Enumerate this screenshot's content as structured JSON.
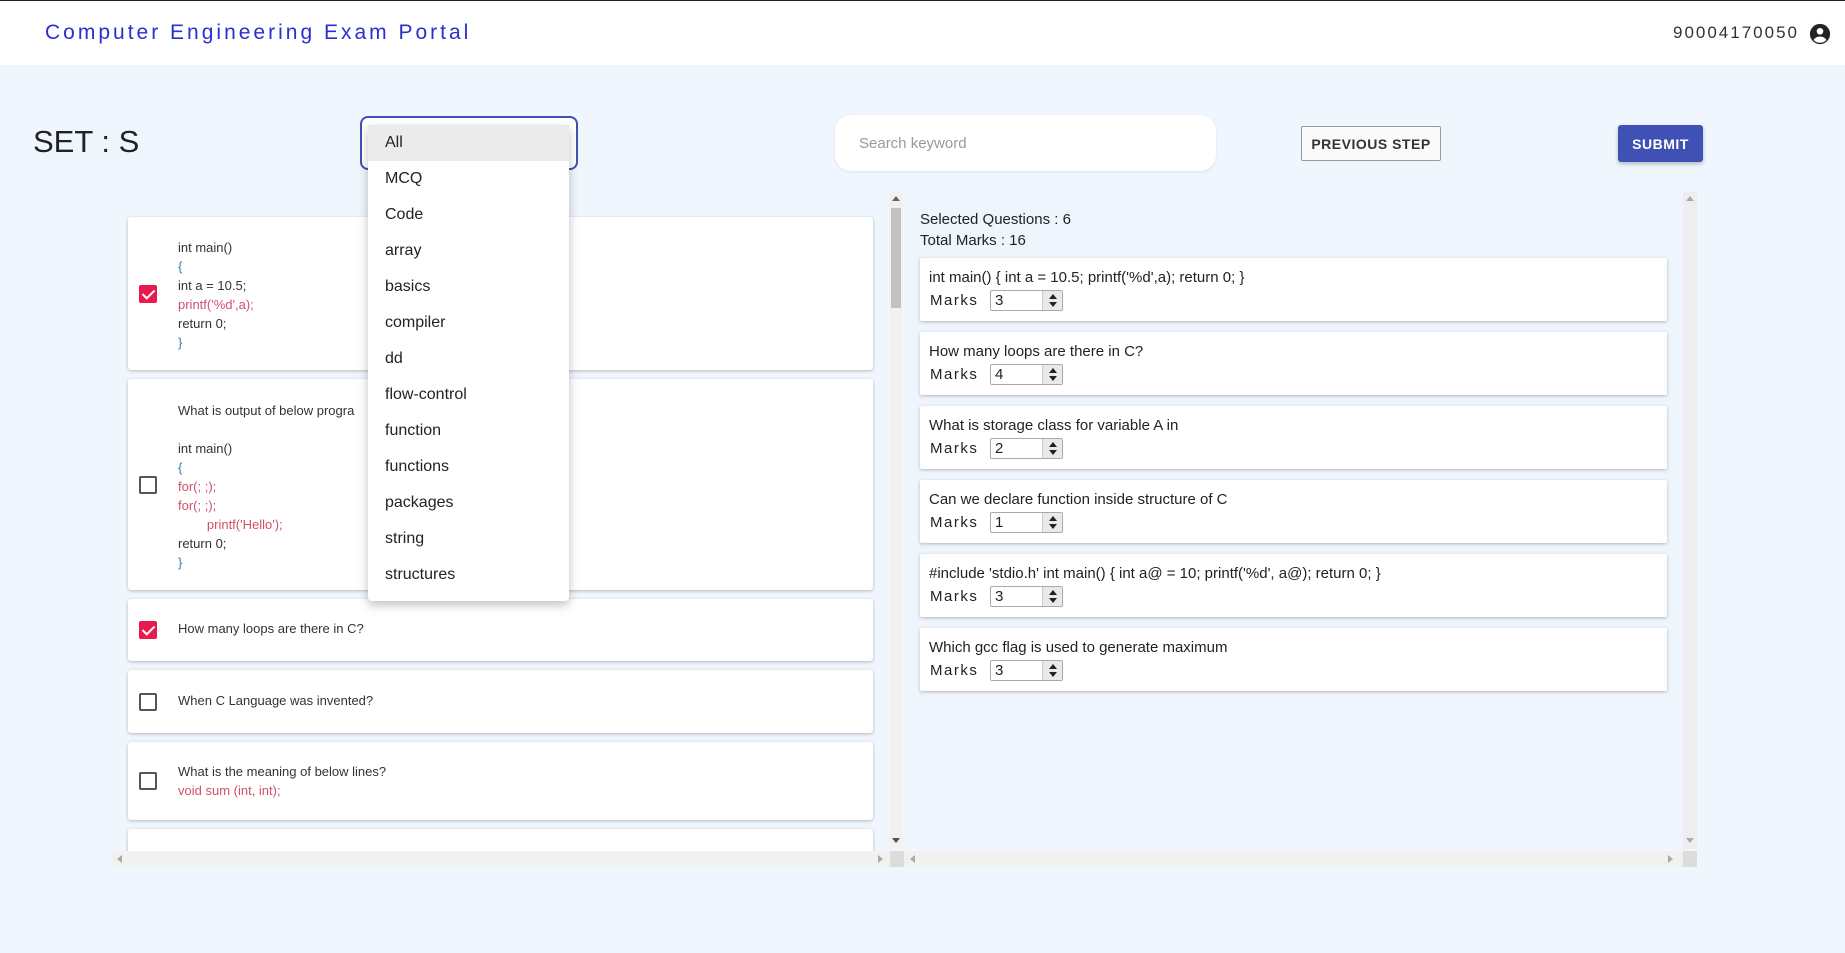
{
  "app": {
    "title": "Computer Engineering Exam Portal",
    "user_phone": "90004170050"
  },
  "set_label": "SET : S",
  "search": {
    "placeholder": "Search keyword"
  },
  "buttons": {
    "previous": "PREVIOUS STEP",
    "submit": "SUBMIT"
  },
  "dropdown": {
    "selected": "All",
    "options": [
      "All",
      "MCQ",
      "Code",
      "array",
      "basics",
      "compiler",
      "dd",
      "flow-control",
      "function",
      "functions",
      "packages",
      "string",
      "structures"
    ]
  },
  "questions": [
    {
      "checked": true,
      "lines": [
        "int main()",
        "{",
        "int a = 10.5;",
        "printf('%d',a);",
        "return 0;",
        "}"
      ]
    },
    {
      "checked": false,
      "lines": [
        "What is output of below progra",
        "",
        "int main()",
        "{",
        "for(; ;);",
        "for(; ;);",
        "        printf('Hello');",
        "return 0;",
        "}"
      ]
    },
    {
      "checked": true,
      "lines": [
        "How many loops are there in C?"
      ]
    },
    {
      "checked": false,
      "lines": [
        "When C Language was invented?"
      ]
    },
    {
      "checked": false,
      "lines": [
        "What is the meaning of below lines?",
        "void sum (int, int);"
      ]
    }
  ],
  "summary": {
    "selected_questions": "Selected Questions : 6",
    "total_marks": "Total Marks : 16"
  },
  "marks_label": "Marks",
  "selected": [
    {
      "title": "int main() { int a = 10.5; printf('%d',a); return 0; }",
      "marks": "3"
    },
    {
      "title": "How many loops are there in C?",
      "marks": "4"
    },
    {
      "title": "What is storage class for variable A in",
      "marks": "2"
    },
    {
      "title": "Can we declare function inside structure of C",
      "marks": "1"
    },
    {
      "title": "#include 'stdio.h' int main() { int a@ = 10; printf('%d', a@); return 0; }",
      "marks": "3"
    },
    {
      "title": "Which gcc flag is used to generate maximum",
      "marks": "3"
    }
  ]
}
